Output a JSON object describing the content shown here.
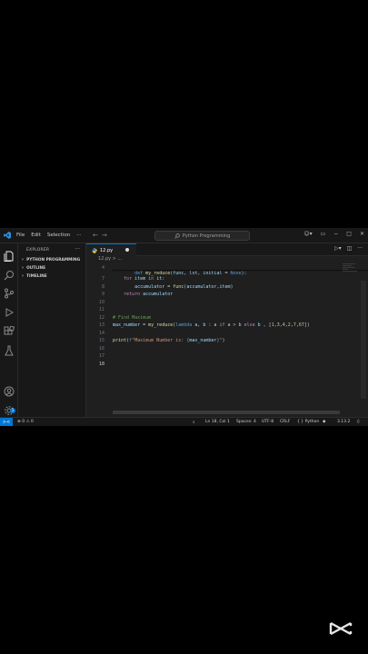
{
  "menu": [
    "File",
    "Edit",
    "Selection",
    "···"
  ],
  "command_center": "Python Programming",
  "sidebar": {
    "title": "EXPLORER",
    "more": "···",
    "sections": [
      "PYTHON PROGRAMMING",
      "OUTLINE",
      "TIMELINE"
    ]
  },
  "tab": {
    "label": "12.py",
    "modified": true
  },
  "breadcrumb": "12.py > ...",
  "editor": {
    "line_numbers": [
      "4",
      "7",
      "8",
      "9",
      "10",
      "11",
      "12",
      "13",
      "14",
      "15",
      "16",
      "17",
      "18"
    ],
    "sticky_line": "def my_reduce(func, lst, initial = None):",
    "lines": [
      "    for item in it:",
      "        accumulator = func(accumulator,item)",
      "    return accumulator",
      "",
      "",
      "# Find Maximum",
      "max_number = my_reduce(lambda a, b : a if a > b else b , [1,3,4,2,7,67])",
      "",
      "print(f\"Maximum Number is: {max_number}\")",
      "",
      "",
      ""
    ]
  },
  "status": {
    "remote": "><",
    "problems": "⊗ 0 ⚠ 0",
    "position": "Ln 18, Col 1",
    "spaces": "Spaces: 4",
    "encoding": "UTF-8",
    "eol": "CRLF",
    "language": "{ } Python",
    "version": "3.13.2"
  },
  "colors": {
    "accent": "#0078d4",
    "background": "#1f1f1f",
    "panel": "#181818"
  }
}
